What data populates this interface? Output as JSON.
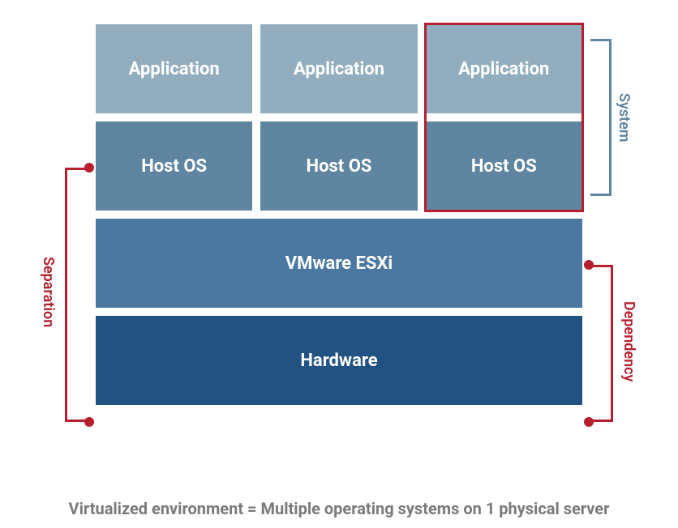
{
  "rows": {
    "app": [
      "Application",
      "Application",
      "Application"
    ],
    "os": [
      "Host OS",
      "Host OS",
      "Host OS"
    ],
    "hypervisor": "VMware ESXi",
    "hardware": "Hardware"
  },
  "annotations": {
    "system": "System",
    "separation": "Separation",
    "dependency": "Dependency"
  },
  "caption": "Virtualized environment = Multiple operating systems on 1 physical server",
  "colors": {
    "app": "#92aebe",
    "os": "#5f85a1",
    "hypervisor": "#4a78a0",
    "hardware": "#225282",
    "highlight": "#b61f2e",
    "bracket_system": "#5f85a1",
    "caption": "#7a7a7a"
  }
}
